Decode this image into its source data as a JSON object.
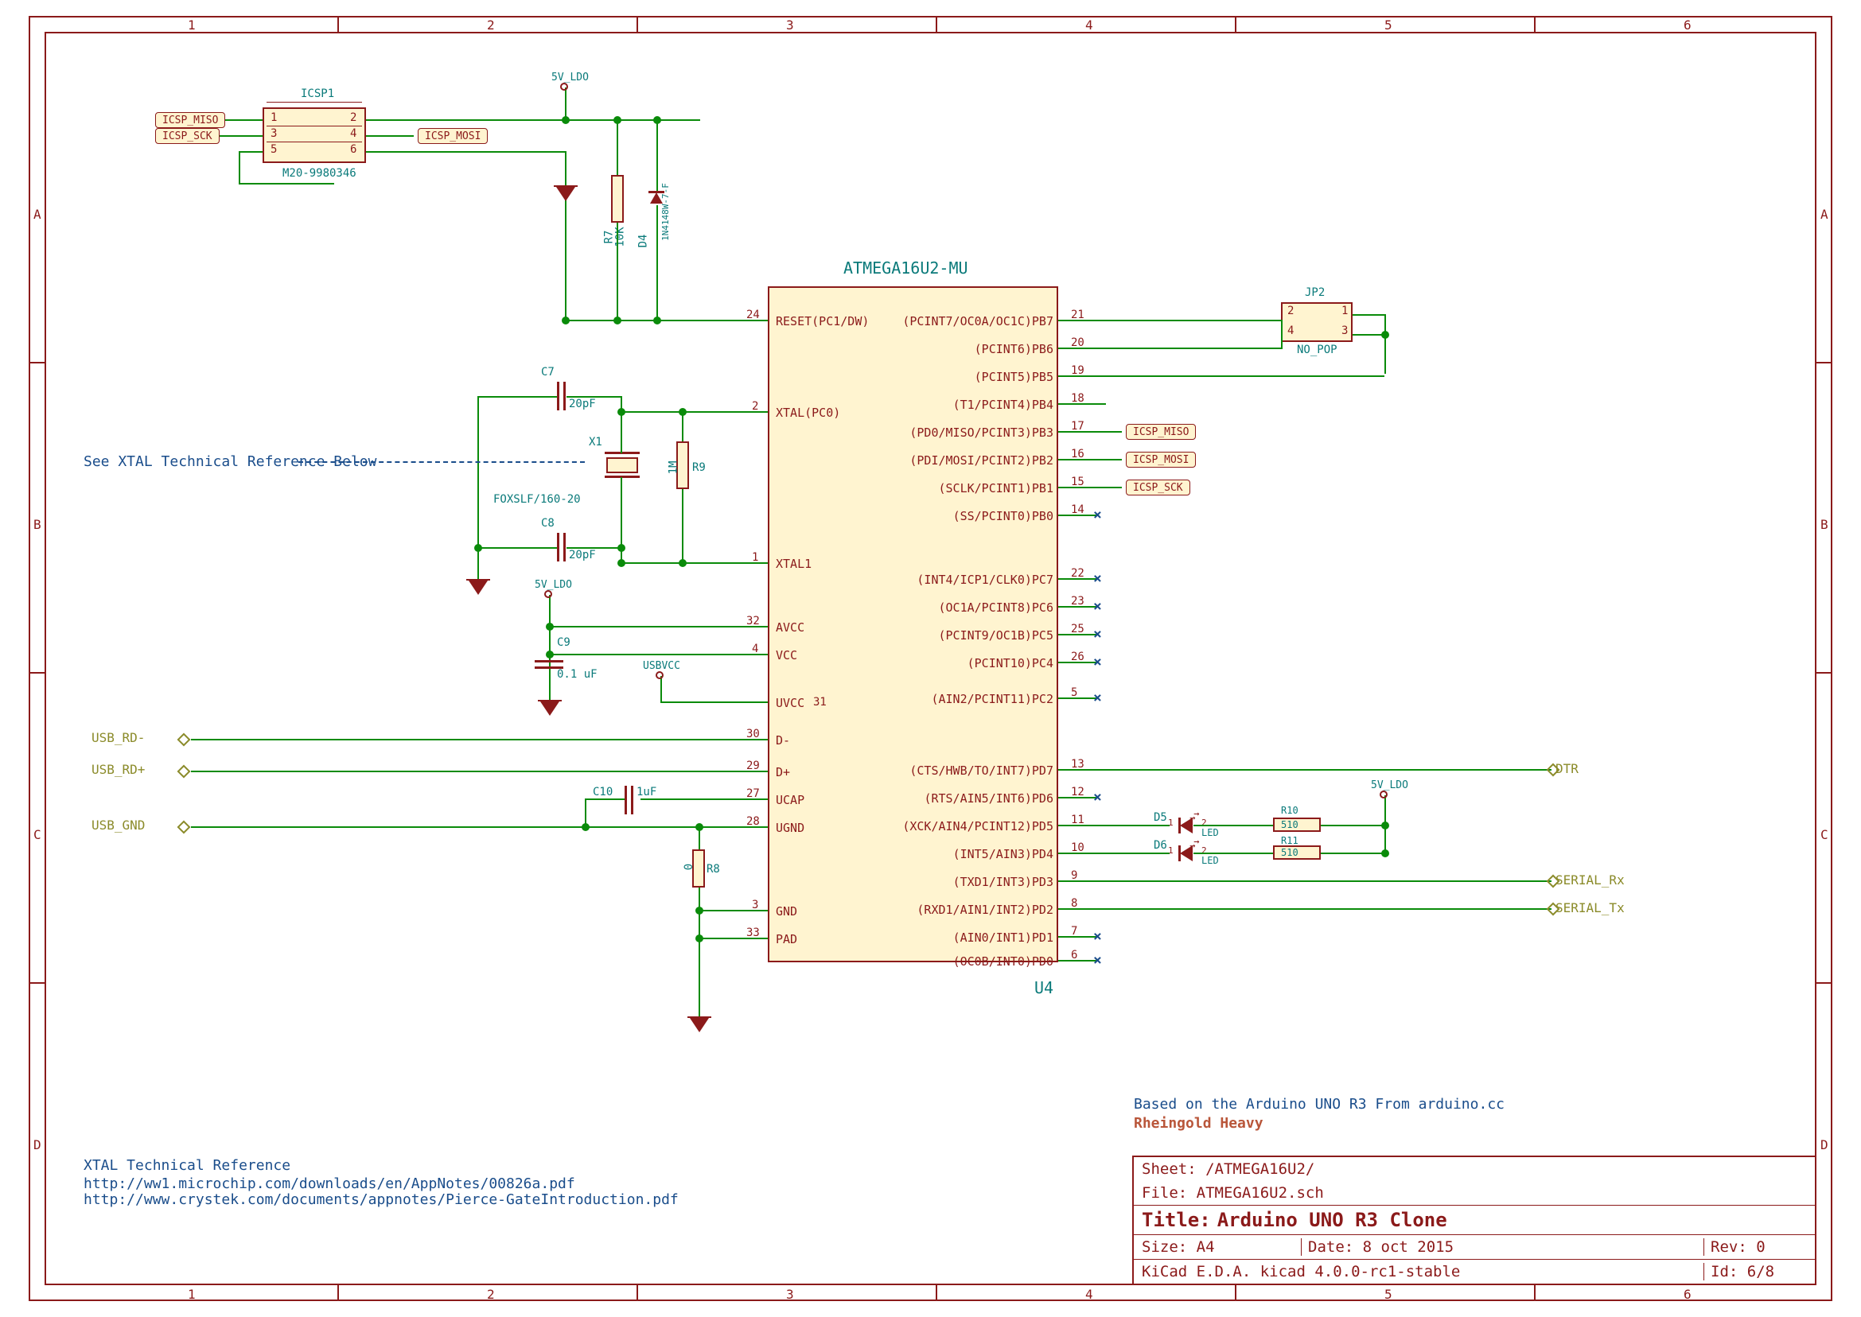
{
  "frame": {
    "ruler_cols": [
      "1",
      "2",
      "3",
      "4",
      "5",
      "6"
    ],
    "ruler_rows": [
      "A",
      "B",
      "C",
      "D"
    ]
  },
  "chip": {
    "part": "ATMEGA16U2-MU",
    "ref": "U4",
    "left_pins": [
      {
        "num": "24",
        "label": "RESET(PC1/DW)"
      },
      {
        "num": "2",
        "label": "XTAL(PC0)"
      },
      {
        "num": "1",
        "label": "XTAL1"
      },
      {
        "num": "32",
        "label": "AVCC"
      },
      {
        "num": "4",
        "label": "VCC"
      },
      {
        "num": "",
        "label": "UVCC"
      },
      {
        "num": "30",
        "label": "D-"
      },
      {
        "num": "29",
        "label": "D+"
      },
      {
        "num": "27",
        "label": "UCAP"
      },
      {
        "num": "28",
        "label": "UGND"
      },
      {
        "num": "3",
        "label": "GND"
      },
      {
        "num": "33",
        "label": "PAD"
      }
    ],
    "right_pins": [
      {
        "num": "21",
        "label": "(PCINT7/OC0A/OC1C)PB7"
      },
      {
        "num": "20",
        "label": "(PCINT6)PB6"
      },
      {
        "num": "19",
        "label": "(PCINT5)PB5"
      },
      {
        "num": "18",
        "label": "(T1/PCINT4)PB4"
      },
      {
        "num": "17",
        "label": "(PD0/MISO/PCINT3)PB3"
      },
      {
        "num": "16",
        "label": "(PDI/MOSI/PCINT2)PB2"
      },
      {
        "num": "15",
        "label": "(SCLK/PCINT1)PB1"
      },
      {
        "num": "14",
        "label": "(SS/PCINT0)PB0"
      },
      {
        "num": "22",
        "label": "(INT4/ICP1/CLK0)PC7"
      },
      {
        "num": "23",
        "label": "(OC1A/PCINT8)PC6"
      },
      {
        "num": "25",
        "label": "(PCINT9/OC1B)PC5"
      },
      {
        "num": "26",
        "label": "(PCINT10)PC4"
      },
      {
        "num": "5",
        "label": "(AIN2/PCINT11)PC2"
      },
      {
        "num": "13",
        "label": "(CTS/HWB/TO/INT7)PD7"
      },
      {
        "num": "12",
        "label": "(RTS/AIN5/INT6)PD6"
      },
      {
        "num": "11",
        "label": "(XCK/AIN4/PCINT12)PD5"
      },
      {
        "num": "10",
        "label": "(INT5/AIN3)PD4"
      },
      {
        "num": "9",
        "label": "(TXD1/INT3)PD3"
      },
      {
        "num": "8",
        "label": "(RXD1/AIN1/INT2)PD2"
      },
      {
        "num": "7",
        "label": "(AIN0/INT1)PD1"
      },
      {
        "num": "6",
        "label": "(OC0B/INT0)PD0"
      }
    ],
    "uvcc_num": "31"
  },
  "components": {
    "C7": {
      "ref": "C7",
      "val": "20pF"
    },
    "C8": {
      "ref": "C8",
      "val": "20pF"
    },
    "C9": {
      "ref": "C9",
      "val": "0.1 uF"
    },
    "C10": {
      "ref": "C10",
      "val": "1uF"
    },
    "X1": {
      "ref": "X1",
      "val": "FOXSLF/160-20"
    },
    "R7": {
      "ref": "R7",
      "val": "10K"
    },
    "R8": {
      "ref": "R8",
      "val": "0"
    },
    "R9": {
      "ref": "R9",
      "val": "1M"
    },
    "R10": {
      "ref": "R10",
      "val": "510"
    },
    "R11": {
      "ref": "R11",
      "val": "510"
    },
    "D4": {
      "ref": "D4",
      "val": "1N4148W-7-F"
    },
    "D5": {
      "ref": "D5",
      "val": "LED"
    },
    "D6": {
      "ref": "D6",
      "val": "LED"
    },
    "ICSP1": {
      "ref": "ICSP1",
      "val": "M20-9980346"
    },
    "JP2": {
      "ref": "JP2",
      "val": "NO_POP"
    }
  },
  "nets": {
    "icsp_miso": "ICSP_MISO",
    "icsp_sck": "ICSP_SCK",
    "icsp_mosi": "ICSP_MOSI",
    "usb_rd_minus": "USB_RD-",
    "usb_rd_plus": "USB_RD+",
    "usb_gnd": "USB_GND",
    "dtr": "DTR",
    "serial_rx": "SERIAL_Rx",
    "serial_tx": "SERIAL_Tx"
  },
  "power": {
    "p5v": "5V_LDO",
    "usbvcc": "USBVCC"
  },
  "notes": {
    "xtal_ref": "See XTAL Technical Reference Below",
    "xtal_title": "XTAL Technical Reference",
    "xtal_link1": "http://ww1.microchip.com/downloads/en/AppNotes/00826a.pdf",
    "xtal_link2": "http://www.crystek.com/documents/appnotes/Pierce-GateIntroduction.pdf",
    "based_on": "Based on the Arduino UNO R3 From arduino.cc",
    "company": "Rheingold Heavy"
  },
  "titleblock": {
    "sheet": "Sheet: /ATMEGA16U2/",
    "file": "File: ATMEGA16U2.sch",
    "title_label": "Title:",
    "title": "Arduino UNO R3 Clone",
    "size_label": "Size:",
    "size": "A4",
    "date_label": "Date:",
    "date": "8 oct 2015",
    "rev_label": "Rev:",
    "rev": "0",
    "kicad": "KiCad E.D.A.  kicad 4.0.0-rc1-stable",
    "id": "Id: 6/8"
  }
}
